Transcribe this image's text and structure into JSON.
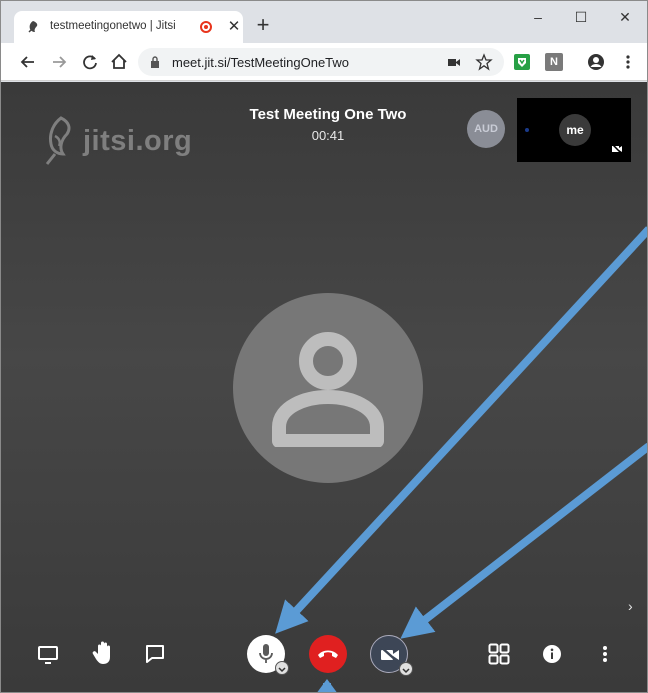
{
  "browser": {
    "tab": {
      "title": "testmeetingonetwo | Jitsi Me",
      "favicon": "jitsi-favicon-icon",
      "recording_indicator": "recording-icon"
    },
    "new_tab_label": "+",
    "window_controls": {
      "minimize": "–",
      "maximize": "☐",
      "close": "✕"
    },
    "toolbar": {
      "url": "meet.jit.si/TestMeetingOneTwo",
      "icons": [
        "back-icon",
        "forward-icon",
        "reload-icon",
        "home-icon",
        "lock-icon",
        "camera-permission-icon",
        "star-icon",
        "extension-shield-icon",
        "extension-n-icon",
        "profile-icon",
        "menu-icon"
      ],
      "extension_n_label": "N"
    }
  },
  "meeting": {
    "logo_text": "jitsi.org",
    "title": "Test Meeting One Two",
    "timer": "00:41",
    "remote_participant_initials": "AUD",
    "local_thumbnail_label": "me",
    "colors": {
      "background": "#3a3a3a",
      "hangup": "#e02020",
      "annotation_arrow": "#5b9bd5"
    }
  },
  "bottom_toolbar": {
    "left": [
      "screenshare-icon",
      "raise-hand-icon",
      "chat-icon"
    ],
    "center": [
      "microphone-icon",
      "hangup-icon",
      "camera-off-icon"
    ],
    "right": [
      "tile-view-icon",
      "info-icon",
      "more-options-icon"
    ]
  }
}
